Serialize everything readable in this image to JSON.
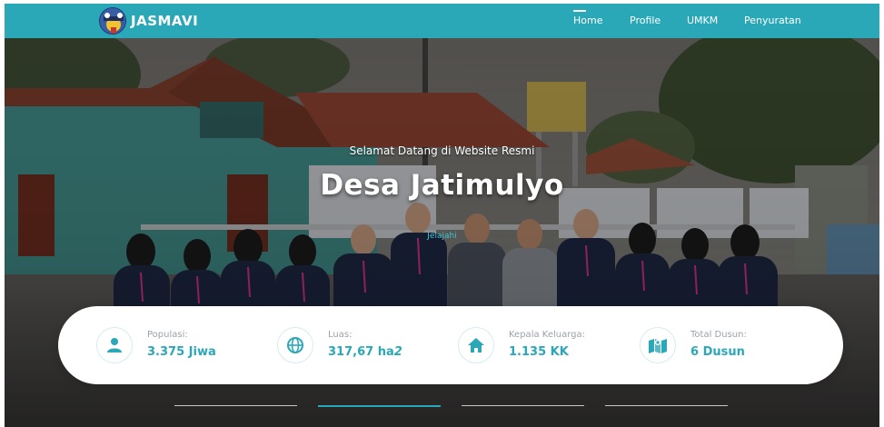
{
  "brand": {
    "name": "JASMAVI"
  },
  "nav": {
    "items": [
      {
        "label": "Home",
        "active": true
      },
      {
        "label": "Profile",
        "active": false
      },
      {
        "label": "UMKM",
        "active": false
      },
      {
        "label": "Penyuratan",
        "active": false
      }
    ]
  },
  "hero": {
    "subtitle": "Selamat Datang di Website Resmi",
    "title": "Desa Jatimulyo",
    "cta": "Jelajahi"
  },
  "stats": [
    {
      "label": "Populasi:",
      "value": "3.375 Jiwa",
      "icon": "person-icon"
    },
    {
      "label": "Luas:",
      "value": "317,67 ha",
      "value_suffix": "2",
      "icon": "globe-icon"
    },
    {
      "label": "Kepala Keluarga:",
      "value": "1.135 KK",
      "icon": "home-icon"
    },
    {
      "label": "Total Dusun:",
      "value": "6 Dusun",
      "icon": "map-icon"
    }
  ],
  "colors": {
    "accent": "#2aa8b8",
    "navbar": "#2aa8b8",
    "label_gray": "#9aa3a8",
    "card": "#ffffff"
  }
}
